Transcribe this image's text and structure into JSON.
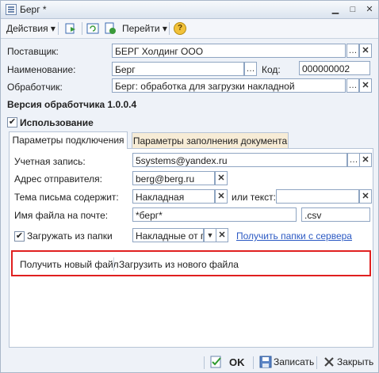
{
  "window": {
    "title": "Берг *",
    "controls": [
      "min",
      "max",
      "close"
    ]
  },
  "toolbar": {
    "actions_label": "Действия",
    "goto_label": "Перейти",
    "help_glyph": "?"
  },
  "form": {
    "supplier": {
      "label": "Поставщик:",
      "value": "БЕРГ Холдинг ООО"
    },
    "name": {
      "label": "Наименование:",
      "value": "Берг"
    },
    "code": {
      "label": "Код:",
      "value": "000000002"
    },
    "handler": {
      "label": "Обработчик:",
      "value": "Берг: обработка для загрузки накладной"
    },
    "version_label": "Версия обработчика 1.0.0.4",
    "usage_label": "Использование",
    "usage_checked": true
  },
  "tabs": [
    {
      "label": "Параметры подключения",
      "active": true
    },
    {
      "label": "Параметры заполнения документа",
      "active": false
    }
  ],
  "connection": {
    "account": {
      "label": "Учетная запись:",
      "value": "5systems@yandex.ru"
    },
    "sender": {
      "label": "Адрес отправителя:",
      "value": "berg@berg.ru"
    },
    "subject": {
      "label": "Тема письма содержит:",
      "value": "Накладная",
      "or_text_label": "или текст:",
      "or_text_value": ""
    },
    "filename": {
      "label": "Имя файла на почте:",
      "value": "*берг*",
      "ext": ".csv"
    },
    "folder": {
      "label": "Загружать из папки",
      "checked": true,
      "value": "Накладные от по",
      "link": "Получить папки с сервера"
    }
  },
  "commands": {
    "get_file": "Получить новый файл",
    "load_file": "Загрузить из нового файла"
  },
  "footer": {
    "ok": "OK",
    "save": "Записать",
    "close": "Закрыть"
  },
  "colors": {
    "accent_border": "#8fa5c2",
    "highlight_red": "#e02020",
    "link": "#2b59c3",
    "tab_inactive": "#f7ecd6"
  }
}
